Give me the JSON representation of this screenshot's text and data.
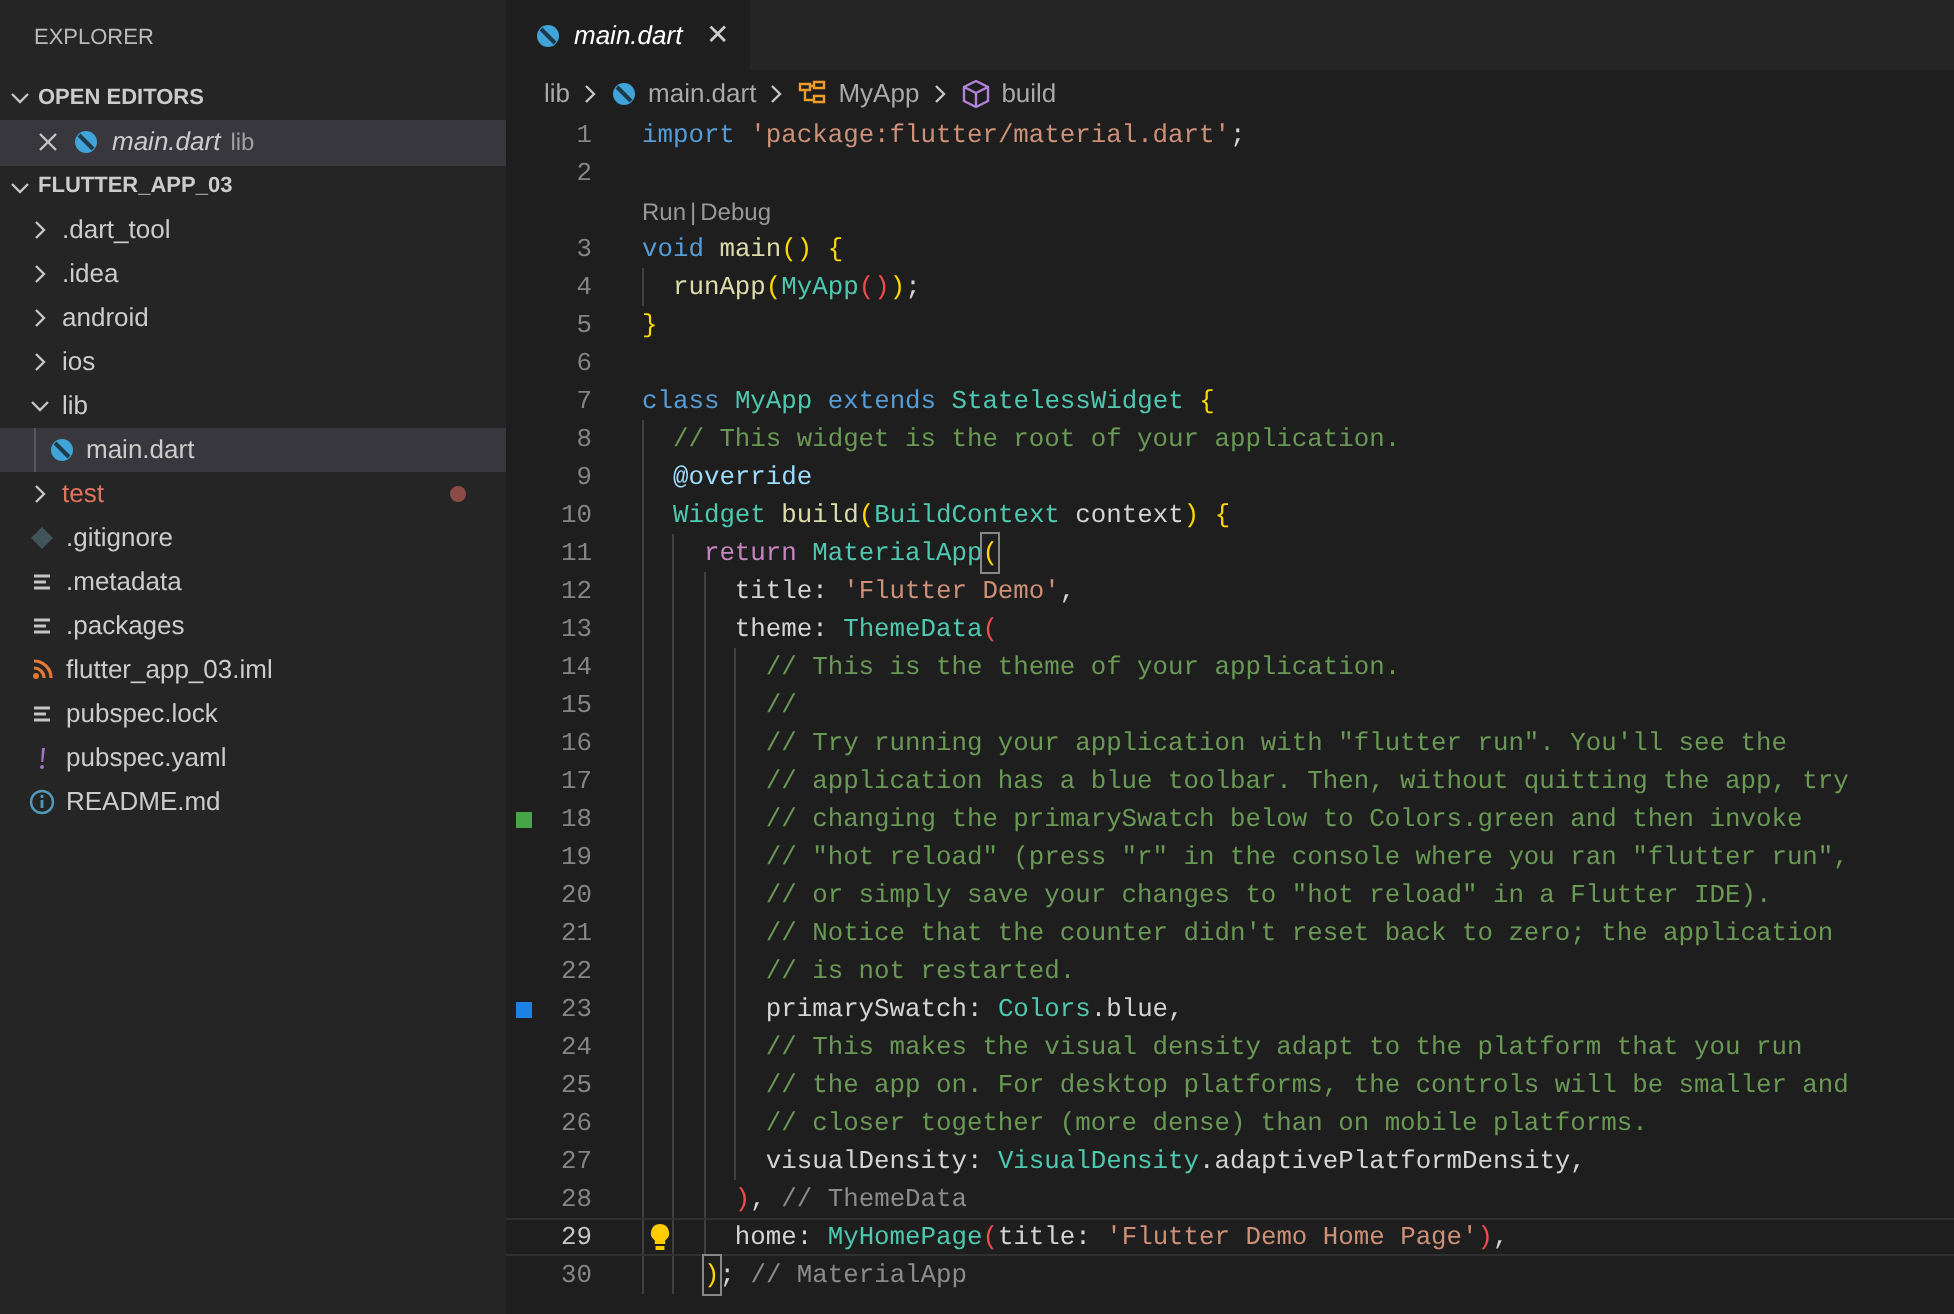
{
  "explorer": {
    "title": "EXPLORER",
    "open_editors": {
      "title": "OPEN EDITORS",
      "expanded": true,
      "items": [
        {
          "label": "main.dart",
          "description": "lib",
          "kind": "dart",
          "selected": true,
          "preview": true
        }
      ]
    },
    "project": {
      "title": "FLUTTER_APP_03",
      "expanded": true,
      "items": [
        {
          "label": ".dart_tool",
          "kind": "folder",
          "expanded": false,
          "selected": false,
          "modified": false
        },
        {
          "label": ".idea",
          "kind": "folder",
          "expanded": false,
          "selected": false,
          "modified": false
        },
        {
          "label": "android",
          "kind": "folder",
          "expanded": false,
          "selected": false,
          "modified": false
        },
        {
          "label": "ios",
          "kind": "folder",
          "expanded": false,
          "selected": false,
          "modified": false
        },
        {
          "label": "lib",
          "kind": "folder",
          "expanded": true,
          "selected": false,
          "modified": false,
          "children": [
            {
              "label": "main.dart",
              "kind": "dart",
              "selected": true,
              "modified": false
            }
          ]
        },
        {
          "label": "test",
          "kind": "folder",
          "expanded": false,
          "selected": false,
          "modified": true
        },
        {
          "label": ".gitignore",
          "kind": "git",
          "selected": false,
          "modified": false
        },
        {
          "label": ".metadata",
          "kind": "lines",
          "selected": false,
          "modified": false
        },
        {
          "label": ".packages",
          "kind": "lines",
          "selected": false,
          "modified": false
        },
        {
          "label": "flutter_app_03.iml",
          "kind": "rss",
          "selected": false,
          "modified": false
        },
        {
          "label": "pubspec.lock",
          "kind": "lines",
          "selected": false,
          "modified": false
        },
        {
          "label": "pubspec.yaml",
          "kind": "yaml",
          "selected": false,
          "modified": false
        },
        {
          "label": "README.md",
          "kind": "info",
          "selected": false,
          "modified": false
        }
      ]
    }
  },
  "tabs": [
    {
      "label": "main.dart",
      "kind": "dart",
      "selected": true,
      "preview": true,
      "close": "✕"
    }
  ],
  "breadcrumbs": [
    {
      "label": "lib",
      "kind": "folder"
    },
    {
      "label": "main.dart",
      "kind": "dart"
    },
    {
      "label": "MyApp",
      "kind": "class"
    },
    {
      "label": "build",
      "kind": "method"
    }
  ],
  "code": [
    {
      "kind": "line",
      "number": "1",
      "tokens": [
        {
          "kind": "kw",
          "text": "import"
        },
        {
          "kind": "str",
          "text": " 'package:flutter/material.dart'"
        },
        {
          "kind": "plain",
          "text": ";"
        }
      ]
    },
    {
      "kind": "line",
      "number": "2"
    },
    {
      "kind": "codelens",
      "links": [
        "Run",
        "Debug"
      ],
      "separator": "|"
    },
    {
      "kind": "line",
      "number": "3",
      "tokens": [
        {
          "kind": "kw",
          "text": "void"
        },
        {
          "kind": "fn",
          "text": " main"
        },
        {
          "kind": "b1",
          "text": "()"
        },
        {
          "kind": "b1",
          "text": " {"
        }
      ]
    },
    {
      "kind": "line",
      "number": "4",
      "tokens": [
        {
          "kind": "fn",
          "text": "  runApp"
        },
        {
          "kind": "b1",
          "text": "("
        },
        {
          "kind": "type",
          "text": "MyApp"
        },
        {
          "kind": "b2",
          "text": "()"
        },
        {
          "kind": "b1",
          "text": ")"
        },
        {
          "kind": "plain",
          "text": ";"
        }
      ]
    },
    {
      "kind": "line",
      "number": "5",
      "tokens": [
        {
          "kind": "b1",
          "text": "}"
        }
      ]
    },
    {
      "kind": "line",
      "number": "6"
    },
    {
      "kind": "line",
      "number": "7",
      "tokens": [
        {
          "kind": "kw",
          "text": "class"
        },
        {
          "kind": "type",
          "text": " MyApp"
        },
        {
          "kind": "kw",
          "text": " extends"
        },
        {
          "kind": "type",
          "text": " StatelessWidget"
        },
        {
          "kind": "b1",
          "text": " {"
        }
      ]
    },
    {
      "kind": "line",
      "number": "8",
      "tokens": [
        {
          "kind": "cmt",
          "text": "  // This widget is the root of your application."
        }
      ]
    },
    {
      "kind": "line",
      "number": "9",
      "tokens": [
        {
          "kind": "meta",
          "text": "  @override"
        }
      ]
    },
    {
      "kind": "line",
      "number": "10",
      "tokens": [
        {
          "kind": "type",
          "text": "  Widget"
        },
        {
          "kind": "fn",
          "text": " build"
        },
        {
          "kind": "b1",
          "text": "("
        },
        {
          "kind": "type",
          "text": "BuildContext"
        },
        {
          "kind": "plain",
          "text": " context"
        },
        {
          "kind": "b1",
          "text": ")"
        },
        {
          "kind": "b1",
          "text": " {"
        }
      ]
    },
    {
      "kind": "line",
      "number": "11",
      "tokens": [
        {
          "kind": "ctrl",
          "text": "    return"
        },
        {
          "kind": "type",
          "text": " MaterialApp"
        },
        {
          "kind": "b1",
          "text": "(",
          "matched": true
        }
      ]
    },
    {
      "kind": "line",
      "number": "12",
      "tokens": [
        {
          "kind": "plain",
          "text": "      title: "
        },
        {
          "kind": "str",
          "text": "'Flutter Demo'"
        },
        {
          "kind": "plain",
          "text": ","
        }
      ]
    },
    {
      "kind": "line",
      "number": "13",
      "tokens": [
        {
          "kind": "plain",
          "text": "      theme: "
        },
        {
          "kind": "type",
          "text": "ThemeData"
        },
        {
          "kind": "b2",
          "text": "("
        }
      ]
    },
    {
      "kind": "line",
      "number": "14",
      "tokens": [
        {
          "kind": "cmt",
          "text": "        // This is the theme of your application."
        }
      ]
    },
    {
      "kind": "line",
      "number": "15",
      "tokens": [
        {
          "kind": "cmt",
          "text": "        //"
        }
      ]
    },
    {
      "kind": "line",
      "number": "16",
      "tokens": [
        {
          "kind": "cmt",
          "text": "        // Try running your application with \"flutter run\". You'll see the"
        }
      ]
    },
    {
      "kind": "line",
      "number": "17",
      "tokens": [
        {
          "kind": "cmt",
          "text": "        // application has a blue toolbar. Then, without quitting the app, try"
        }
      ]
    },
    {
      "kind": "line",
      "number": "18",
      "marker": {
        "kind": "added"
      },
      "tokens": [
        {
          "kind": "cmt",
          "text": "        // changing the primarySwatch below to Colors.green and then invoke"
        }
      ]
    },
    {
      "kind": "line",
      "number": "19",
      "tokens": [
        {
          "kind": "cmt",
          "text": "        // \"hot reload\" (press \"r\" in the console where you ran \"flutter run\","
        }
      ]
    },
    {
      "kind": "line",
      "number": "20",
      "tokens": [
        {
          "kind": "cmt",
          "text": "        // or simply save your changes to \"hot reload\" in a Flutter IDE)."
        }
      ]
    },
    {
      "kind": "line",
      "number": "21",
      "tokens": [
        {
          "kind": "cmt",
          "text": "        // Notice that the counter didn't reset back to zero; the application"
        }
      ]
    },
    {
      "kind": "line",
      "number": "22",
      "tokens": [
        {
          "kind": "cmt",
          "text": "        // is not restarted."
        }
      ]
    },
    {
      "kind": "line",
      "number": "23",
      "marker": {
        "kind": "modified"
      },
      "tokens": [
        {
          "kind": "plain",
          "text": "        primarySwatch: "
        },
        {
          "kind": "type",
          "text": "Colors"
        },
        {
          "kind": "plain",
          "text": ".blue,"
        }
      ]
    },
    {
      "kind": "line",
      "number": "24",
      "tokens": [
        {
          "kind": "cmt",
          "text": "        // This makes the visual density adapt to the platform that you run"
        }
      ]
    },
    {
      "kind": "line",
      "number": "25",
      "tokens": [
        {
          "kind": "cmt",
          "text": "        // the app on. For desktop platforms, the controls will be smaller and"
        }
      ]
    },
    {
      "kind": "line",
      "number": "26",
      "tokens": [
        {
          "kind": "cmt",
          "text": "        // closer together (more dense) than on mobile platforms."
        }
      ]
    },
    {
      "kind": "line",
      "number": "27",
      "tokens": [
        {
          "kind": "plain",
          "text": "        visualDensity: "
        },
        {
          "kind": "type",
          "text": "VisualDensity"
        },
        {
          "kind": "plain",
          "text": ".adaptivePlatformDensity,"
        }
      ]
    },
    {
      "kind": "line",
      "number": "28",
      "tokens": [
        {
          "kind": "b2",
          "text": "      )"
        },
        {
          "kind": "plain",
          "text": ","
        },
        {
          "kind": "label",
          "text": " // ThemeData"
        }
      ]
    },
    {
      "kind": "line",
      "number": "29",
      "current": true,
      "lightbulb": true,
      "tokens": [
        {
          "kind": "plain",
          "text": "      home: "
        },
        {
          "kind": "type",
          "text": "MyHomePage"
        },
        {
          "kind": "b2",
          "text": "("
        },
        {
          "kind": "plain",
          "text": "title: "
        },
        {
          "kind": "str",
          "text": "'Flutter Demo Home Page'"
        },
        {
          "kind": "b2",
          "text": ")"
        },
        {
          "kind": "plain",
          "text": ","
        }
      ]
    },
    {
      "kind": "line",
      "number": "30",
      "tokens": [
        {
          "kind": "b1",
          "text": "    )",
          "matched": true
        },
        {
          "kind": "plain",
          "text": ";"
        },
        {
          "kind": "label",
          "text": " // MaterialApp"
        }
      ]
    }
  ]
}
